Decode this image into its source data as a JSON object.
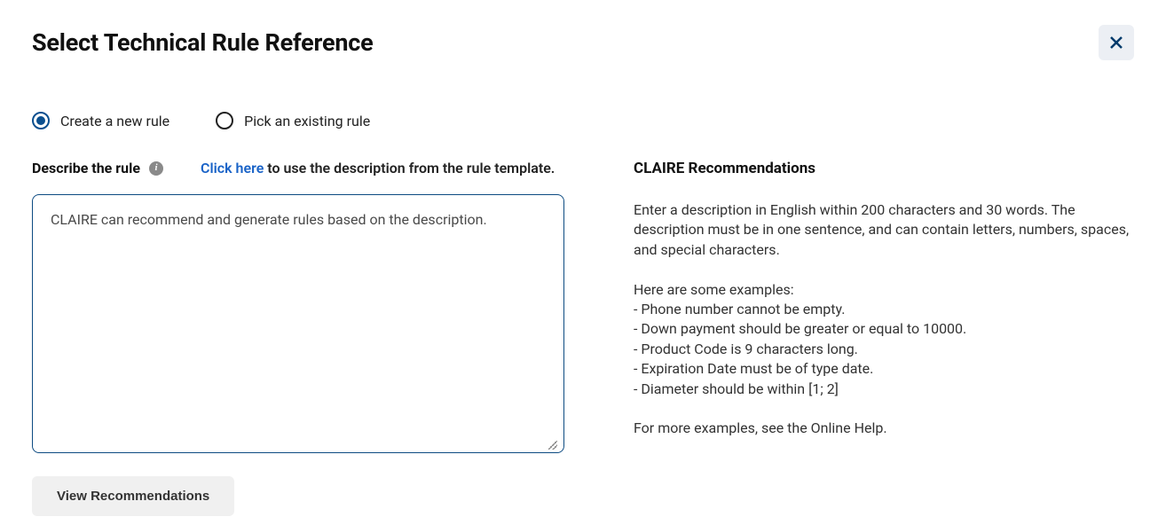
{
  "header": {
    "title": "Select Technical Rule Reference"
  },
  "options": {
    "create": {
      "label": "Create a new rule",
      "selected": true
    },
    "pick": {
      "label": "Pick an existing rule",
      "selected": false
    }
  },
  "describe": {
    "label": "Describe the rule",
    "link_text": "Click here",
    "hint_suffix": " to use the description from the rule template.",
    "placeholder": "CLAIRE can recommend and generate rules based on the description."
  },
  "button": {
    "view_recommendations": "View Recommendations"
  },
  "recommendations": {
    "heading": "CLAIRE Recommendations",
    "body": "Enter a description in English within 200 characters and 30 words. The description must be in one sentence, and can contain letters, numbers, spaces, and special characters.\n\nHere are some examples:\n- Phone number cannot be empty.\n- Down payment should be greater or equal to 10000.\n- Product Code is 9 characters long.\n- Expiration Date must be of type date.\n- Diameter should be within [1; 2]\n\nFor more examples, see the Online Help."
  }
}
